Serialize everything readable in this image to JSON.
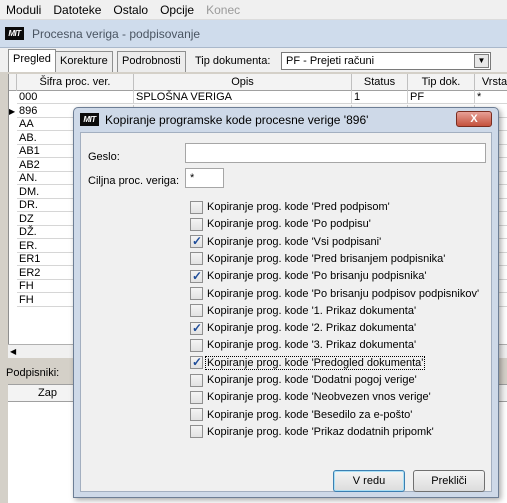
{
  "menu": [
    "Moduli",
    "Datoteke",
    "Ostalo",
    "Opcije",
    "Konec"
  ],
  "window": {
    "logo": "MIT",
    "title": "Procesna veriga - podpisovanje"
  },
  "tabs": [
    {
      "label": "Pregled",
      "active": true
    },
    {
      "label": "Korekture",
      "active": false
    },
    {
      "label": "Podrobnosti",
      "active": false
    }
  ],
  "tip_dokumenta": {
    "label": "Tip dokumenta:",
    "value": "PF  -  Prejeti računi"
  },
  "grid": {
    "columns": [
      "Šifra proc. ver.",
      "Opis",
      "Status",
      "Tip dok.",
      "Vrsta"
    ],
    "rows": [
      [
        "000",
        "SPLOŠNA VERIGA",
        "1",
        "PF",
        "*"
      ],
      [
        "896",
        "",
        "",
        "",
        ""
      ],
      [
        "AA",
        "",
        "",
        "",
        ""
      ],
      [
        "AB.",
        "",
        "",
        "",
        ""
      ],
      [
        "AB1",
        "",
        "",
        "",
        ""
      ],
      [
        "AB2",
        "",
        "",
        "",
        ""
      ],
      [
        "AN.",
        "",
        "",
        "",
        ""
      ],
      [
        "DM.",
        "",
        "",
        "",
        ""
      ],
      [
        "DR.",
        "",
        "",
        "",
        ""
      ],
      [
        "DZ",
        "",
        "",
        "",
        ""
      ],
      [
        "DŽ.",
        "",
        "",
        "",
        ""
      ],
      [
        "ER.",
        "",
        "",
        "",
        ""
      ],
      [
        "ER1",
        "",
        "",
        "",
        ""
      ],
      [
        "ER2",
        "",
        "",
        "",
        ""
      ],
      [
        "FH",
        "",
        "",
        "",
        ""
      ],
      [
        "FH",
        "",
        "",
        "",
        ""
      ]
    ]
  },
  "podpisniki": {
    "label": "Podpisniki:",
    "column": "Zap"
  },
  "dialog": {
    "logo": "MIT",
    "title": "Kopiranje programske kode procesne verige '896'",
    "close": "X",
    "geslo_label": "Geslo:",
    "geslo_value": "",
    "ciljna_label": "Ciljna proc. veriga:",
    "ciljna_value": "*",
    "checkboxes": [
      {
        "label": "Kopiranje prog. kode 'Pred podpisom'",
        "checked": false
      },
      {
        "label": "Kopiranje prog. kode 'Po podpisu'",
        "checked": false
      },
      {
        "label": "Kopiranje prog. kode 'Vsi podpisani'",
        "checked": true
      },
      {
        "label": "Kopiranje prog. kode 'Pred brisanjem podpisnika'",
        "checked": false
      },
      {
        "label": "Kopiranje prog. kode 'Po brisanju podpisnika'",
        "checked": true
      },
      {
        "label": "Kopiranje prog. kode 'Po brisanju podpisov podpisnikov'",
        "checked": false
      },
      {
        "label": "Kopiranje prog. kode '1. Prikaz dokumenta'",
        "checked": false
      },
      {
        "label": "Kopiranje prog. kode '2. Prikaz dokumenta'",
        "checked": true
      },
      {
        "label": "Kopiranje prog. kode '3. Prikaz dokumenta'",
        "checked": false
      },
      {
        "label": "Kopiranje prog. kode 'Predogled dokumenta'",
        "checked": true
      },
      {
        "label": "Kopiranje prog. kode 'Dodatni pogoj verige'",
        "checked": false
      },
      {
        "label": "Kopiranje prog. kode 'Neobvezen vnos verige'",
        "checked": false
      },
      {
        "label": "Kopiranje prog. kode 'Besedilo za e-pošto'",
        "checked": false
      },
      {
        "label": "Kopiranje prog. kode 'Prikaz dodatnih pripomk'",
        "checked": false
      }
    ],
    "ok_label": "V redu",
    "cancel_label": "Prekliči"
  }
}
